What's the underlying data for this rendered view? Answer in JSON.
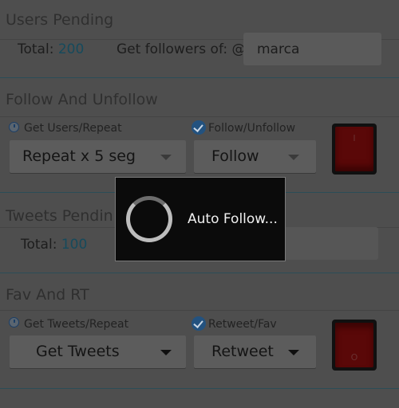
{
  "users_pending": {
    "title": "Users Pending",
    "total_label": "Total:",
    "total_value": "200",
    "get_followers_label": "Get followers of: @",
    "username_value": "marca"
  },
  "follow_unfollow": {
    "title": "Follow And Unfollow",
    "get_users_label": "Get Users/Repeat",
    "follow_toggle_label": "Follow/Unfollow",
    "repeat_selected": "Repeat x 5 seg",
    "action_selected": "Follow"
  },
  "tweets_pending": {
    "title": "Tweets Pendin",
    "total_label": "Total:",
    "total_value": "100"
  },
  "fav_rt": {
    "title": "Fav And RT",
    "get_tweets_label": "Get Tweets/Repeat",
    "retweet_toggle_label": "Retweet/Fav",
    "tweets_selected": "Get Tweets",
    "action_selected": "Retweet"
  },
  "dialog": {
    "message": "Auto Follow..."
  },
  "switch_marks": {
    "on": "I",
    "off": "O"
  }
}
